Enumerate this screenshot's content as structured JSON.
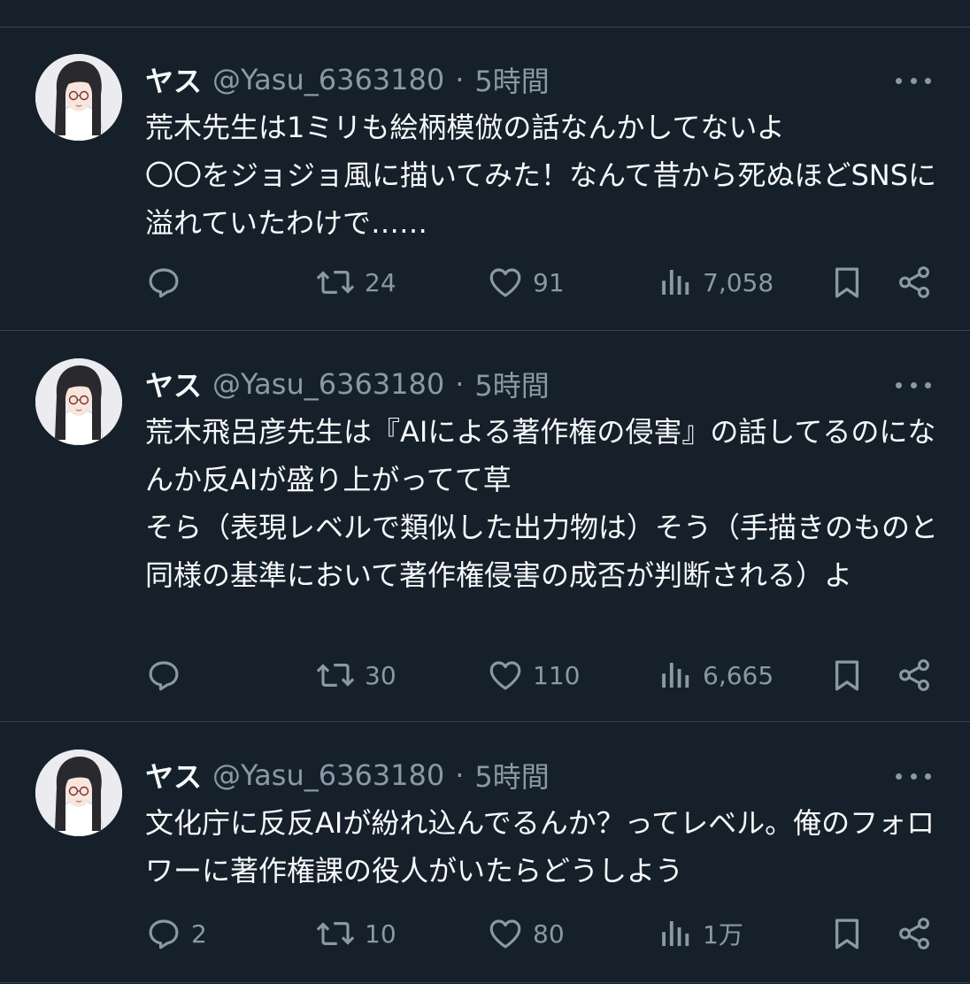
{
  "tweets": [
    {
      "display_name": "ヤス",
      "handle": "@Yasu_6363180",
      "separator": "·",
      "time": "5時間",
      "text": "荒木先生は1ミリも絵柄模倣の話なんかしてないよ\n〇〇をジョジョ風に描いてみた！なんて昔から死ぬほどSNSに溢れていたわけで……",
      "replies": "",
      "retweets": "24",
      "likes": "91",
      "views": "7,058"
    },
    {
      "display_name": "ヤス",
      "handle": "@Yasu_6363180",
      "separator": "·",
      "time": "5時間",
      "text": "荒木飛呂彦先生は『AIによる著作権の侵害』の話してるのになんか反AIが盛り上がってて草\nそら（表現レベルで類似した出力物は）そう（手描きのものと同様の基準において著作権侵害の成否が判断される）よ",
      "replies": "",
      "retweets": "30",
      "likes": "110",
      "views": "6,665"
    },
    {
      "display_name": "ヤス",
      "handle": "@Yasu_6363180",
      "separator": "·",
      "time": "5時間",
      "text": "文化庁に反反AIが紛れ込んでるんか？ってレベル。俺のフォロワーに著作権課の役人がいたらどうしよう",
      "replies": "2",
      "retweets": "10",
      "likes": "80",
      "views": "1万"
    }
  ],
  "icons": {
    "reply": "reply-icon",
    "retweet": "retweet-icon",
    "like": "heart-icon",
    "views": "views-icon",
    "bookmark": "bookmark-icon",
    "share": "share-icon",
    "more": "more-icon"
  },
  "colors": {
    "background": "#15202b",
    "text": "#f7f9f9",
    "secondary": "#8b98a5",
    "divider": "#38444d"
  }
}
